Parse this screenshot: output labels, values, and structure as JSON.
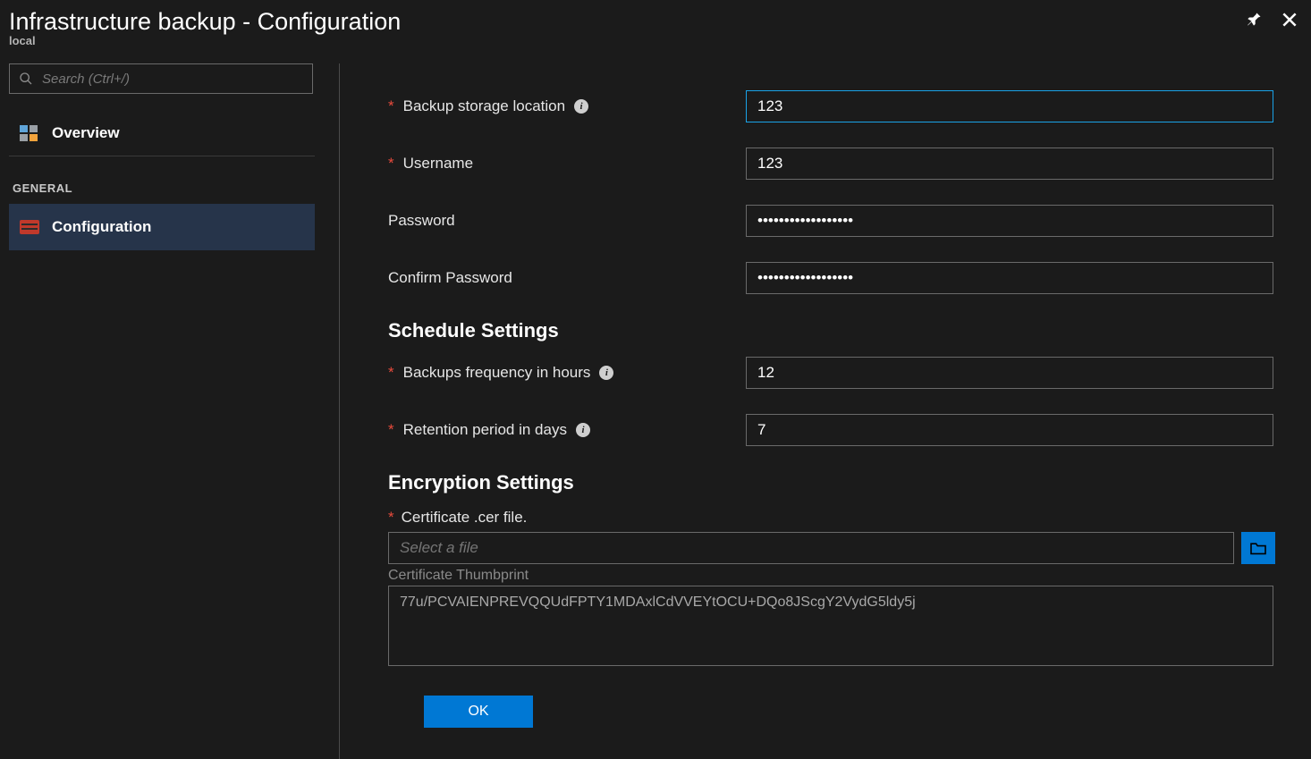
{
  "header": {
    "title": "Infrastructure backup - Configuration",
    "subtitle": "local"
  },
  "sidebar": {
    "search_placeholder": "Search (Ctrl+/)",
    "nav": {
      "overview_label": "Overview",
      "section_label": "GENERAL",
      "configuration_label": "Configuration"
    }
  },
  "form": {
    "backup_location": {
      "label": "Backup storage location",
      "value": "123"
    },
    "username": {
      "label": "Username",
      "value": "123"
    },
    "password": {
      "label": "Password",
      "value": "••••••••••••••••••"
    },
    "confirm_password": {
      "label": "Confirm Password",
      "value": "••••••••••••••••••"
    },
    "schedule_heading": "Schedule Settings",
    "frequency": {
      "label": "Backups frequency in hours",
      "value": "12"
    },
    "retention": {
      "label": "Retention period in days",
      "value": "7"
    },
    "encryption_heading": "Encryption Settings",
    "cert_file": {
      "label": "Certificate .cer file.",
      "placeholder": "Select a file"
    },
    "thumbprint": {
      "label": "Certificate Thumbprint",
      "value": "77u/PCVAIENPREVQQUdFPTY1MDAxlCdVVEYtOCU+DQo8JScgY2VydG5ldy5j"
    },
    "ok_label": "OK"
  }
}
